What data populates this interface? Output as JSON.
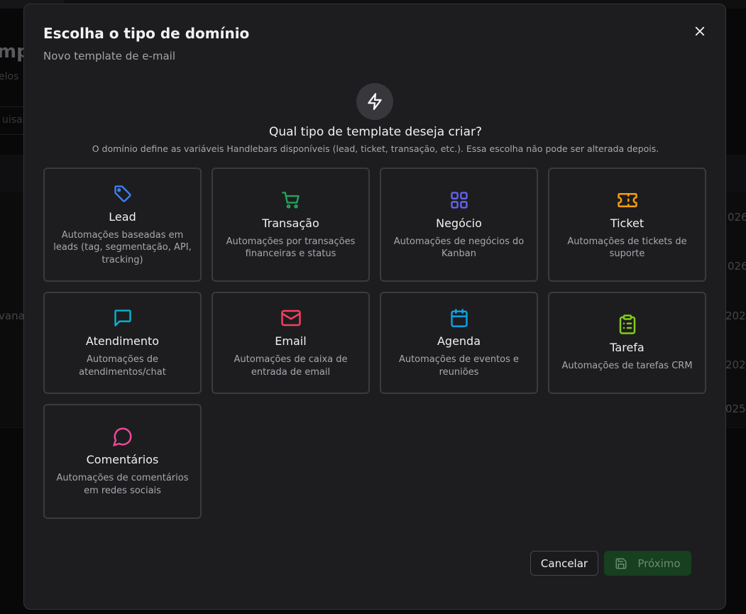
{
  "background": {
    "title": "mp",
    "subtitle": "elos",
    "search_placeholder": "uisar..",
    "row_cells": [
      "026",
      "026",
      "202",
      "202",
      "025"
    ],
    "row_name": "vana"
  },
  "modal": {
    "title": "Escolha o tipo de domínio",
    "subtitle": "Novo template de e-mail",
    "question": "Qual tipo de template deseja criar?",
    "hint": "O domínio define as variáveis Handlebars disponíveis (lead, ticket, transação, etc.). Essa escolha não pode ser alterada depois.",
    "cards": [
      {
        "title": "Lead",
        "desc": "Automações baseadas em leads (tag, segmentação, API, tracking)",
        "icon": "tag-icon",
        "color": "#3b82f6"
      },
      {
        "title": "Transação",
        "desc": "Automações por transações financeiras e status",
        "icon": "cart-icon",
        "color": "#22a559"
      },
      {
        "title": "Negócio",
        "desc": "Automações de negócios do Kanban",
        "icon": "grid-icon",
        "color": "#6366f1"
      },
      {
        "title": "Ticket",
        "desc": "Automações de tickets de suporte",
        "icon": "ticket-icon",
        "color": "#f59e0b"
      },
      {
        "title": "Atendimento",
        "desc": "Automações de atendimentos/chat",
        "icon": "message-square-icon",
        "color": "#06b6d4"
      },
      {
        "title": "Email",
        "desc": "Automações de caixa de entrada de email",
        "icon": "mail-icon",
        "color": "#f43f5e"
      },
      {
        "title": "Agenda",
        "desc": "Automações de eventos e reuniões",
        "icon": "calendar-icon",
        "color": "#0ea5e9"
      },
      {
        "title": "Tarefa",
        "desc": "Automações de tarefas CRM",
        "icon": "clipboard-list-icon",
        "color": "#84cc16"
      },
      {
        "title": "Comentários",
        "desc": "Automações de comentários em redes sociais",
        "icon": "message-circle-icon",
        "color": "#ec4899"
      }
    ],
    "cancel_label": "Cancelar",
    "next_label": "Próximo"
  }
}
